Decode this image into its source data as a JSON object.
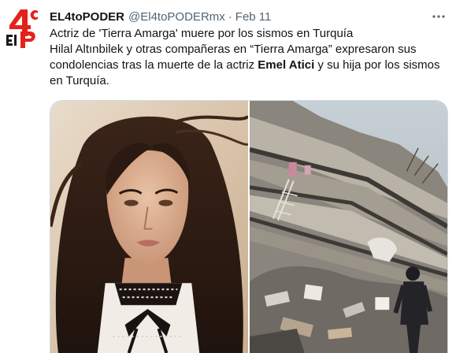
{
  "tweet": {
    "author_name": "EL4toPODER",
    "handle": "@El4toPODERmx",
    "separator": "·",
    "date": "Feb 11",
    "more_icon": "more-horizontal-icon",
    "text_line1": "Actriz de 'Tierra Amarga' muere por los sismos en Turquía",
    "text_line2": "Hilal Altınbilek y otras compañeras en “Tierra Amarga” expresaron sus",
    "text_line3_pre": "condolencias tras la muerte de la actriz ",
    "text_line3_bold": "Emel Atici",
    "text_line3_post": " y su hija por los sismos",
    "text_line4": "en Turquía."
  },
  "avatar": {
    "logo_number": "4",
    "logo_superscript": "to",
    "logo_text": "El P",
    "logo_color": "#e2231a"
  },
  "media": {
    "photos": [
      "actress-portrait-photo",
      "earthquake-rubble-photo"
    ]
  },
  "colors": {
    "text_primary": "#0f1419",
    "text_secondary": "#536471",
    "border": "#cfd9de"
  }
}
